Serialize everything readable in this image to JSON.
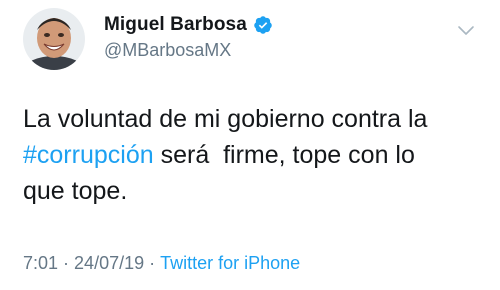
{
  "author": {
    "display_name": "Miguel Barbosa",
    "handle": "@MBarbosaMX",
    "verified_icon": "verified-badge-icon"
  },
  "menu": {
    "icon": "chevron-down-icon"
  },
  "tweet": {
    "text_before": "La voluntad de mi gobierno contra la\n",
    "hashtag": "#corrupción",
    "text_after": " será  firme, tope con lo\nque tope."
  },
  "meta": {
    "time": "7:01",
    "separator1": " · ",
    "date": "24/07/19",
    "separator2": " · ",
    "source": "Twitter for iPhone"
  },
  "colors": {
    "link": "#1da1f2",
    "secondary": "#657786",
    "text": "#14171a"
  }
}
